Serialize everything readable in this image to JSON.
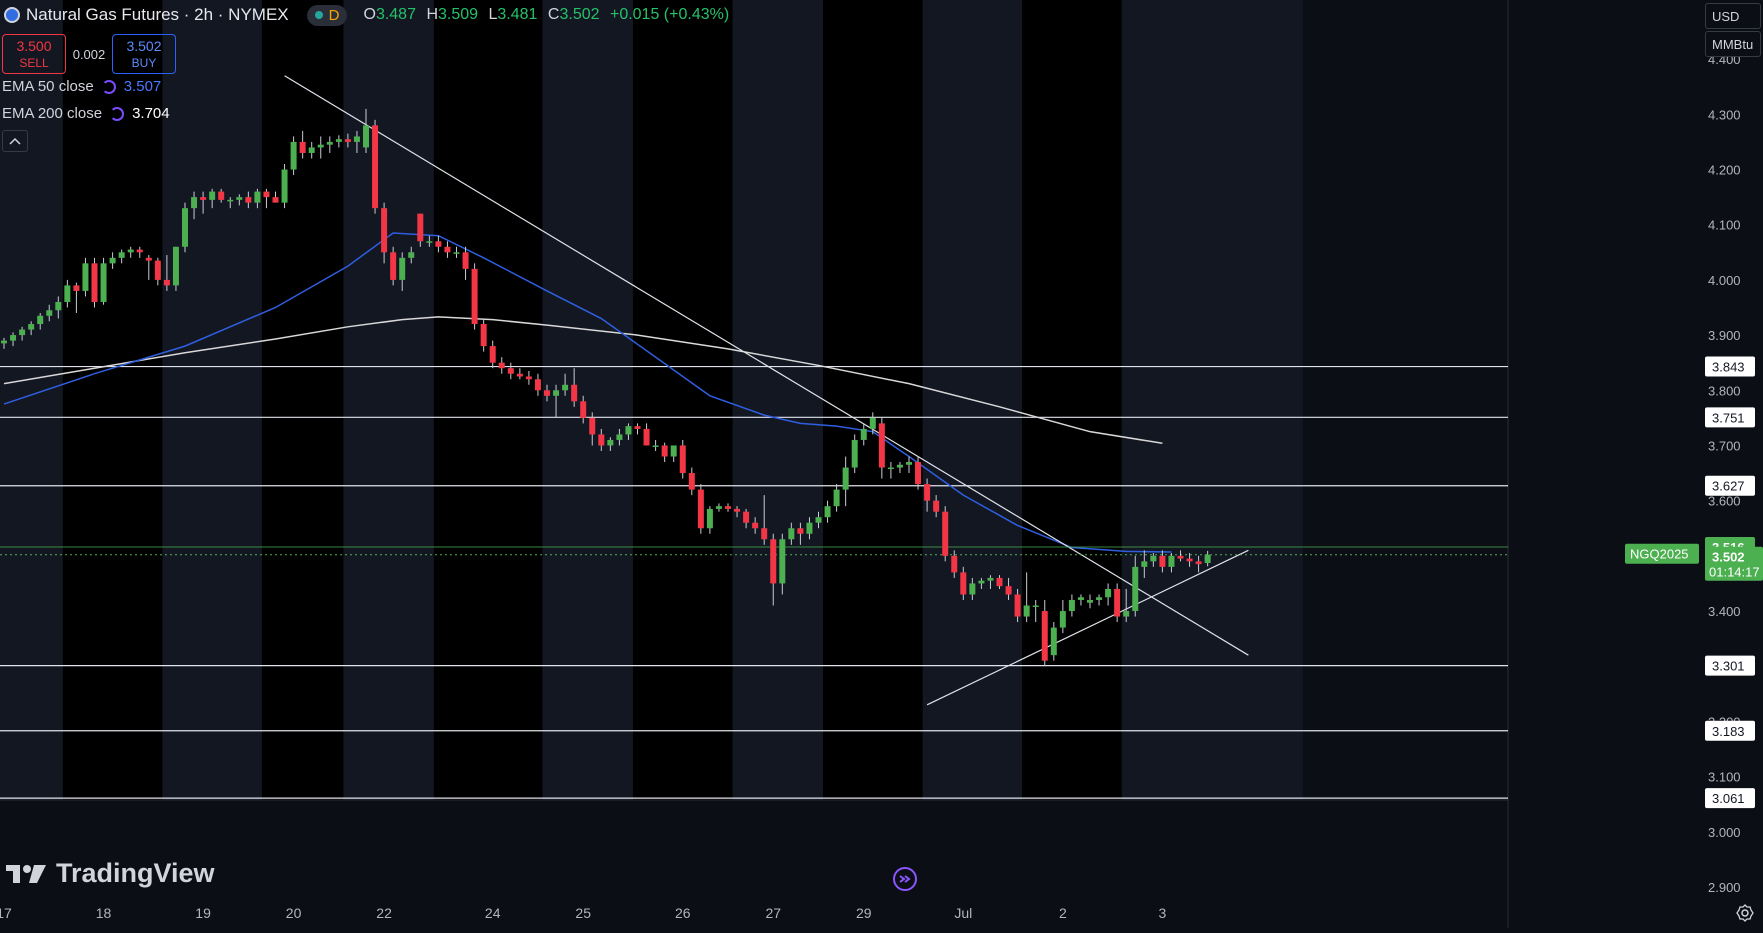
{
  "header": {
    "title": "Natural Gas Futures · 2h · NYMEX",
    "market_status_label": "D",
    "ohlc": [
      {
        "key": "O",
        "value": "3.487"
      },
      {
        "key": "H",
        "value": "3.509"
      },
      {
        "key": "L",
        "value": "3.481"
      },
      {
        "key": "C",
        "value": "3.502"
      }
    ],
    "change": "+0.015 (+0.43%)"
  },
  "trade": {
    "sell_price": "3.500",
    "sell_label": "SELL",
    "spread": "0.002",
    "buy_price": "3.502",
    "buy_label": "BUY"
  },
  "indicators": [
    {
      "label": "EMA 50 close",
      "value": "3.507",
      "color": "#2962ff"
    },
    {
      "label": "EMA 200 close",
      "value": "3.704",
      "color": "#ffffff"
    }
  ],
  "axis_controls": {
    "currency": "USD",
    "unit": "MMBtu",
    "collapse_icon": "chevron-up-icon"
  },
  "brand": {
    "name": "TradingView"
  },
  "chart_data": {
    "type": "candlestick",
    "ylim": [
      2.88,
      4.48
    ],
    "yticks": [
      2.9,
      3.0,
      3.1,
      3.2,
      3.3,
      3.4,
      3.5,
      3.6,
      3.7,
      3.8,
      3.9,
      4.0,
      4.1,
      4.2,
      4.3,
      4.4
    ],
    "x_tick_labels": [
      {
        "label": "17",
        "bar": 0
      },
      {
        "label": "18",
        "bar": 11
      },
      {
        "label": "19",
        "bar": 22
      },
      {
        "label": "20",
        "bar": 32
      },
      {
        "label": "22",
        "bar": 42
      },
      {
        "label": "24",
        "bar": 54
      },
      {
        "label": "25",
        "bar": 64
      },
      {
        "label": "26",
        "bar": 75
      },
      {
        "label": "27",
        "bar": 85
      },
      {
        "label": "29",
        "bar": 95
      },
      {
        "label": "Jul",
        "bar": 106
      },
      {
        "label": "2",
        "bar": 117
      },
      {
        "label": "3",
        "bar": 128
      }
    ],
    "session_breaks": [
      7,
      18,
      29,
      38,
      48,
      60,
      70,
      81,
      91,
      102,
      113,
      124
    ],
    "up_color": "#26a69a",
    "candle_up_color": "#4caf50",
    "candle_down_color": "#f23645",
    "candles": [
      [
        3.885,
        3.895,
        3.875,
        3.89
      ],
      [
        3.89,
        3.905,
        3.88,
        3.9
      ],
      [
        3.9,
        3.915,
        3.89,
        3.91
      ],
      [
        3.91,
        3.925,
        3.9,
        3.92
      ],
      [
        3.92,
        3.94,
        3.91,
        3.935
      ],
      [
        3.935,
        3.955,
        3.925,
        3.945
      ],
      [
        3.945,
        3.97,
        3.93,
        3.96
      ],
      [
        3.96,
        4.0,
        3.95,
        3.99
      ],
      [
        3.99,
        3.995,
        3.94,
        3.98
      ],
      [
        3.98,
        4.04,
        3.97,
        4.03
      ],
      [
        4.03,
        4.04,
        3.95,
        3.96
      ],
      [
        3.96,
        4.04,
        3.955,
        4.03
      ],
      [
        4.03,
        4.05,
        4.02,
        4.04
      ],
      [
        4.04,
        4.055,
        4.03,
        4.05
      ],
      [
        4.05,
        4.06,
        4.04,
        4.055
      ],
      [
        4.055,
        4.06,
        4.04,
        4.05
      ],
      [
        4.04,
        4.045,
        4.0,
        4.035
      ],
      [
        4.035,
        4.04,
        3.99,
        4.0
      ],
      [
        4.0,
        4.045,
        3.98,
        3.99
      ],
      [
        3.99,
        4.06,
        3.98,
        4.06
      ],
      [
        4.06,
        4.14,
        4.05,
        4.13
      ],
      [
        4.13,
        4.16,
        4.11,
        4.15
      ],
      [
        4.15,
        4.16,
        4.12,
        4.145
      ],
      [
        4.145,
        4.165,
        4.13,
        4.16
      ],
      [
        4.16,
        4.165,
        4.14,
        4.145
      ],
      [
        4.145,
        4.15,
        4.13,
        4.145
      ],
      [
        4.145,
        4.155,
        4.135,
        4.15
      ],
      [
        4.15,
        4.16,
        4.13,
        4.14
      ],
      [
        4.14,
        4.165,
        4.13,
        4.16
      ],
      [
        4.16,
        4.165,
        4.13,
        4.15
      ],
      [
        4.15,
        4.16,
        4.14,
        4.14
      ],
      [
        4.14,
        4.21,
        4.13,
        4.2
      ],
      [
        4.2,
        4.26,
        4.19,
        4.25
      ],
      [
        4.25,
        4.27,
        4.22,
        4.23
      ],
      [
        4.23,
        4.25,
        4.22,
        4.24
      ],
      [
        4.24,
        4.26,
        4.22,
        4.245
      ],
      [
        4.245,
        4.26,
        4.23,
        4.25
      ],
      [
        4.25,
        4.262,
        4.24,
        4.255
      ],
      [
        4.255,
        4.265,
        4.24,
        4.25
      ],
      [
        4.25,
        4.27,
        4.23,
        4.26
      ],
      [
        4.24,
        4.31,
        4.23,
        4.28
      ],
      [
        4.28,
        4.29,
        4.12,
        4.13
      ],
      [
        4.13,
        4.14,
        4.03,
        4.05
      ],
      [
        4.05,
        4.06,
        3.99,
        4.0
      ],
      [
        4.0,
        4.05,
        3.98,
        4.04
      ],
      [
        4.04,
        4.06,
        4.03,
        4.05
      ],
      [
        4.12,
        4.12,
        4.06,
        4.07
      ],
      [
        4.07,
        4.08,
        4.06,
        4.07
      ],
      [
        4.07,
        4.08,
        4.05,
        4.06
      ],
      [
        4.06,
        4.07,
        4.04,
        4.05
      ],
      [
        4.05,
        4.06,
        4.04,
        4.05
      ],
      [
        4.05,
        4.06,
        4.0,
        4.02
      ],
      [
        4.02,
        4.03,
        3.91,
        3.92
      ],
      [
        3.92,
        3.93,
        3.87,
        3.88
      ],
      [
        3.88,
        3.89,
        3.84,
        3.85
      ],
      [
        3.85,
        3.86,
        3.83,
        3.84
      ],
      [
        3.84,
        3.85,
        3.82,
        3.83
      ],
      [
        3.83,
        3.84,
        3.82,
        3.825
      ],
      [
        3.825,
        3.835,
        3.81,
        3.82
      ],
      [
        3.82,
        3.83,
        3.79,
        3.8
      ],
      [
        3.8,
        3.81,
        3.78,
        3.79
      ],
      [
        3.79,
        3.81,
        3.75,
        3.8
      ],
      [
        3.8,
        3.83,
        3.79,
        3.81
      ],
      [
        3.81,
        3.84,
        3.77,
        3.78
      ],
      [
        3.78,
        3.79,
        3.74,
        3.75
      ],
      [
        3.75,
        3.76,
        3.7,
        3.72
      ],
      [
        3.72,
        3.73,
        3.69,
        3.7
      ],
      [
        3.7,
        3.715,
        3.69,
        3.71
      ],
      [
        3.71,
        3.73,
        3.7,
        3.72
      ],
      [
        3.72,
        3.74,
        3.71,
        3.735
      ],
      [
        3.735,
        3.74,
        3.72,
        3.73
      ],
      [
        3.73,
        3.74,
        3.7,
        3.7
      ],
      [
        3.7,
        3.71,
        3.69,
        3.7
      ],
      [
        3.7,
        3.705,
        3.67,
        3.68
      ],
      [
        3.68,
        3.7,
        3.67,
        3.7
      ],
      [
        3.7,
        3.71,
        3.64,
        3.65
      ],
      [
        3.65,
        3.66,
        3.61,
        3.62
      ],
      [
        3.62,
        3.63,
        3.54,
        3.55
      ],
      [
        3.55,
        3.59,
        3.54,
        3.585
      ],
      [
        3.585,
        3.595,
        3.58,
        3.59
      ],
      [
        3.59,
        3.595,
        3.58,
        3.585
      ],
      [
        3.585,
        3.59,
        3.57,
        3.58
      ],
      [
        3.58,
        3.585,
        3.55,
        3.56
      ],
      [
        3.56,
        3.57,
        3.54,
        3.55
      ],
      [
        3.55,
        3.61,
        3.52,
        3.53
      ],
      [
        3.53,
        3.54,
        3.41,
        3.45
      ],
      [
        3.45,
        3.54,
        3.43,
        3.53
      ],
      [
        3.53,
        3.56,
        3.52,
        3.55
      ],
      [
        3.55,
        3.56,
        3.52,
        3.54
      ],
      [
        3.54,
        3.57,
        3.53,
        3.56
      ],
      [
        3.56,
        3.58,
        3.55,
        3.57
      ],
      [
        3.57,
        3.6,
        3.56,
        3.59
      ],
      [
        3.59,
        3.63,
        3.58,
        3.62
      ],
      [
        3.62,
        3.68,
        3.59,
        3.66
      ],
      [
        3.66,
        3.72,
        3.65,
        3.71
      ],
      [
        3.71,
        3.74,
        3.7,
        3.73
      ],
      [
        3.73,
        3.76,
        3.72,
        3.75
      ],
      [
        3.74,
        3.75,
        3.64,
        3.66
      ],
      [
        3.66,
        3.67,
        3.64,
        3.66
      ],
      [
        3.66,
        3.67,
        3.65,
        3.665
      ],
      [
        3.665,
        3.68,
        3.65,
        3.67
      ],
      [
        3.67,
        3.68,
        3.62,
        3.63
      ],
      [
        3.63,
        3.64,
        3.58,
        3.6
      ],
      [
        3.6,
        3.61,
        3.57,
        3.58
      ],
      [
        3.58,
        3.59,
        3.49,
        3.5
      ],
      [
        3.5,
        3.51,
        3.46,
        3.47
      ],
      [
        3.47,
        3.48,
        3.42,
        3.43
      ],
      [
        3.43,
        3.46,
        3.42,
        3.45
      ],
      [
        3.45,
        3.46,
        3.44,
        3.455
      ],
      [
        3.455,
        3.465,
        3.44,
        3.46
      ],
      [
        3.46,
        3.465,
        3.44,
        3.445
      ],
      [
        3.445,
        3.46,
        3.42,
        3.43
      ],
      [
        3.43,
        3.44,
        3.38,
        3.39
      ],
      [
        3.39,
        3.47,
        3.38,
        3.41
      ],
      [
        3.41,
        3.42,
        3.38,
        3.41
      ],
      [
        3.4,
        3.42,
        3.3,
        3.31
      ],
      [
        3.32,
        3.38,
        3.31,
        3.37
      ],
      [
        3.37,
        3.42,
        3.36,
        3.4
      ],
      [
        3.4,
        3.43,
        3.39,
        3.42
      ],
      [
        3.42,
        3.43,
        3.41,
        3.425
      ],
      [
        3.415,
        3.43,
        3.405,
        3.42
      ],
      [
        3.42,
        3.43,
        3.41,
        3.425
      ],
      [
        3.425,
        3.45,
        3.41,
        3.44
      ],
      [
        3.44,
        3.45,
        3.38,
        3.39
      ],
      [
        3.39,
        3.44,
        3.38,
        3.4
      ],
      [
        3.4,
        3.5,
        3.39,
        3.48
      ],
      [
        3.48,
        3.51,
        3.46,
        3.49
      ],
      [
        3.49,
        3.505,
        3.48,
        3.5
      ],
      [
        3.5,
        3.51,
        3.47,
        3.48
      ],
      [
        3.48,
        3.505,
        3.47,
        3.5
      ],
      [
        3.5,
        3.51,
        3.49,
        3.495
      ],
      [
        3.495,
        3.505,
        3.48,
        3.49
      ],
      [
        3.49,
        3.5,
        3.47,
        3.485
      ],
      [
        3.487,
        3.509,
        3.481,
        3.502
      ]
    ],
    "ema50": [
      [
        0,
        3.775
      ],
      [
        10,
        3.83
      ],
      [
        20,
        3.88
      ],
      [
        30,
        3.95
      ],
      [
        38,
        4.025
      ],
      [
        43,
        4.085
      ],
      [
        48,
        4.08
      ],
      [
        53,
        4.04
      ],
      [
        60,
        3.98
      ],
      [
        66,
        3.93
      ],
      [
        72,
        3.86
      ],
      [
        78,
        3.79
      ],
      [
        84,
        3.755
      ],
      [
        88,
        3.74
      ],
      [
        92,
        3.735
      ],
      [
        96,
        3.725
      ],
      [
        100,
        3.68
      ],
      [
        106,
        3.61
      ],
      [
        112,
        3.555
      ],
      [
        118,
        3.515
      ],
      [
        124,
        3.508
      ],
      [
        129,
        3.507
      ]
    ],
    "ema200": [
      [
        0,
        3.812
      ],
      [
        10,
        3.84
      ],
      [
        20,
        3.868
      ],
      [
        30,
        3.893
      ],
      [
        38,
        3.915
      ],
      [
        44,
        3.928
      ],
      [
        48,
        3.933
      ],
      [
        54,
        3.928
      ],
      [
        60,
        3.918
      ],
      [
        70,
        3.9
      ],
      [
        80,
        3.875
      ],
      [
        90,
        3.845
      ],
      [
        100,
        3.812
      ],
      [
        110,
        3.77
      ],
      [
        120,
        3.725
      ],
      [
        128,
        3.704
      ]
    ],
    "trendlines": [
      {
        "from": [
          31,
          4.37
        ],
        "to": [
          137.5,
          3.32
        ]
      },
      {
        "from": [
          102,
          3.23
        ],
        "to": [
          137.5,
          3.51
        ]
      }
    ],
    "horizontal_levels": [
      {
        "value": 3.843,
        "label": "3.843"
      },
      {
        "value": 3.751,
        "label": "3.751"
      },
      {
        "value": 3.627,
        "label": "3.627"
      },
      {
        "value": 3.301,
        "label": "3.301"
      },
      {
        "value": 3.183,
        "label": "3.183"
      },
      {
        "value": 3.061,
        "label": "3.061"
      }
    ],
    "price_markers": [
      {
        "label": "3.516",
        "value": 3.516,
        "color": "#4caf50"
      },
      {
        "label": "3.502",
        "value": 3.502,
        "countdown": "01:14:17",
        "color": "#4caf50",
        "tag": "NGQ2025"
      }
    ],
    "hidden_tick_labels": [
      3.3,
      3.2
    ]
  }
}
